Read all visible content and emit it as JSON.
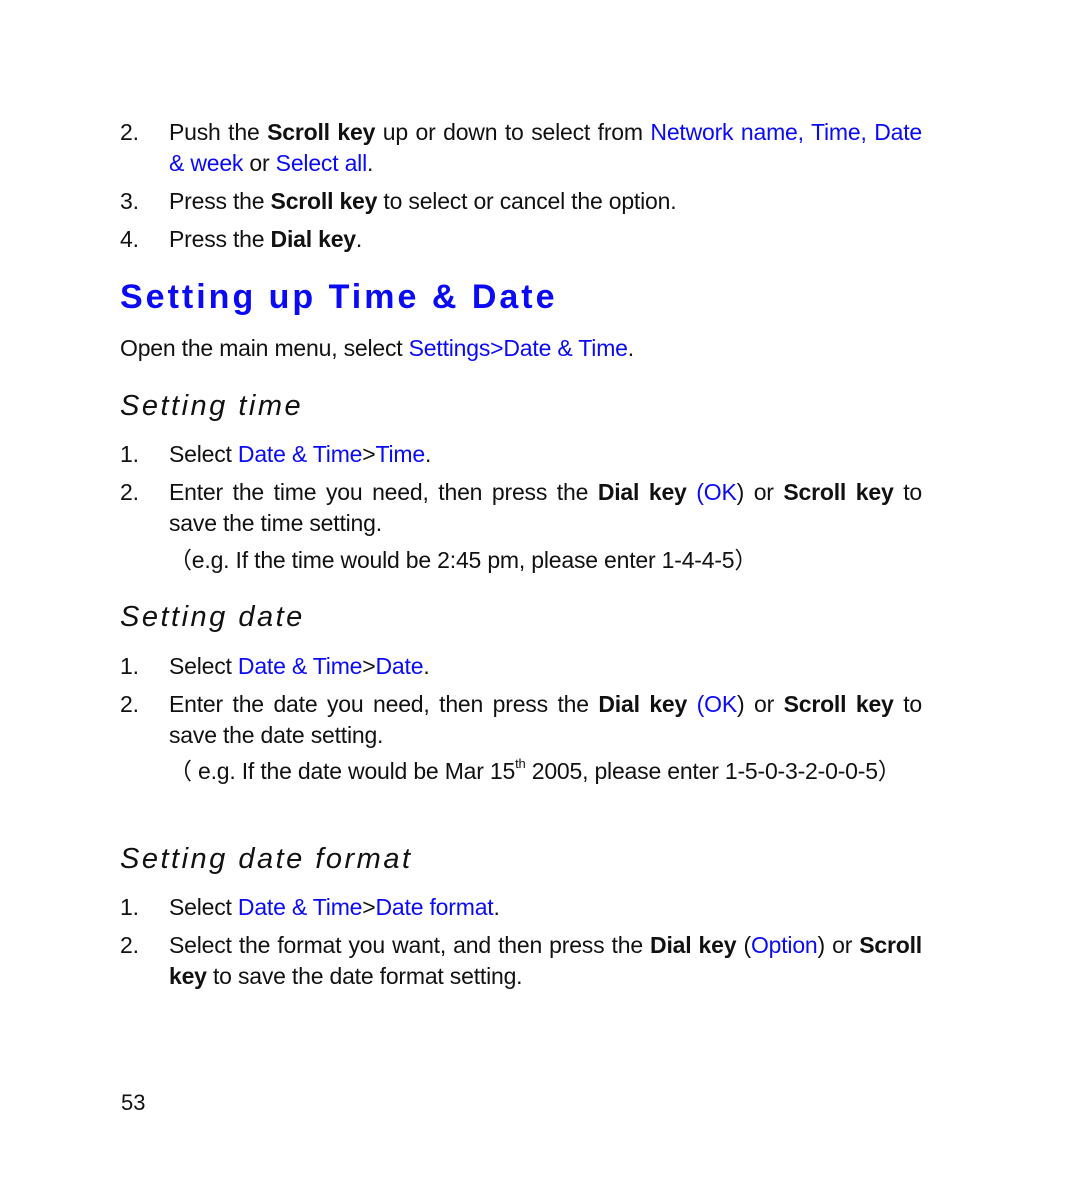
{
  "intro_steps": [
    {
      "number": "2.",
      "parts": {
        "a": "Push the ",
        "b": "Scroll key",
        "c": " up or down to select from ",
        "d": "Network name, Time, Date & week",
        "e": " or ",
        "f": "Select all",
        "g": "."
      }
    },
    {
      "number": "3.",
      "parts": {
        "a": "Press the ",
        "b": "Scroll key",
        "c": " to select or cancel the option."
      }
    },
    {
      "number": "4.",
      "parts": {
        "a": "Press the ",
        "b": "Dial key",
        "c": "."
      }
    }
  ],
  "section": {
    "title": "Setting up Time & Date",
    "intro_prefix": "Open the main menu, select ",
    "intro_link": "Settings>Date & Time",
    "intro_suffix": "."
  },
  "setting_time": {
    "heading": "Setting time",
    "step1": {
      "number": "1.",
      "prefix": "Select ",
      "menu": "Date & Time",
      "sep": ">",
      "target": "Time",
      "suffix": "."
    },
    "step2": {
      "number": "2.",
      "a": "Enter the time you need, then press the ",
      "b": "Dial key",
      "c": " ",
      "d": "(OK",
      "e": ") or ",
      "f": "Scroll key",
      "g": " to save the time setting."
    },
    "example": "（e.g. If the time would be 2:45 pm, please enter 1-4-4-5）"
  },
  "setting_date": {
    "heading": "Setting date",
    "step1": {
      "number": "1.",
      "prefix": "Select ",
      "menu": "Date & Time",
      "sep": ">",
      "target": "Date",
      "suffix": "."
    },
    "step2": {
      "number": "2.",
      "a": "Enter the date you need, then press the ",
      "b": "Dial key",
      "c": " ",
      "d": "(OK",
      "e": ") or ",
      "f": "Scroll key",
      "g": " to save the date setting."
    },
    "example": {
      "a": "（ e.g. If the date would be Mar 15",
      "sup": "th",
      "b": " 2005, please enter 1-5-0-3-2-0-0-5）"
    }
  },
  "setting_date_format": {
    "heading": "Setting date format",
    "step1": {
      "number": "1.",
      "prefix": "Select ",
      "menu": "Date & Time",
      "sep": ">",
      "target": "Date format",
      "suffix": "."
    },
    "step2": {
      "number": "2.",
      "a": "Select the format you want, and then press the ",
      "b": "Dial key",
      "c": " (",
      "d": "Option",
      "e": ") or ",
      "f": "Scroll key",
      "g": " to save the date format setting."
    }
  },
  "page_number": "53",
  "colors": {
    "link_blue": "#0a0af5",
    "text": "#111111"
  }
}
